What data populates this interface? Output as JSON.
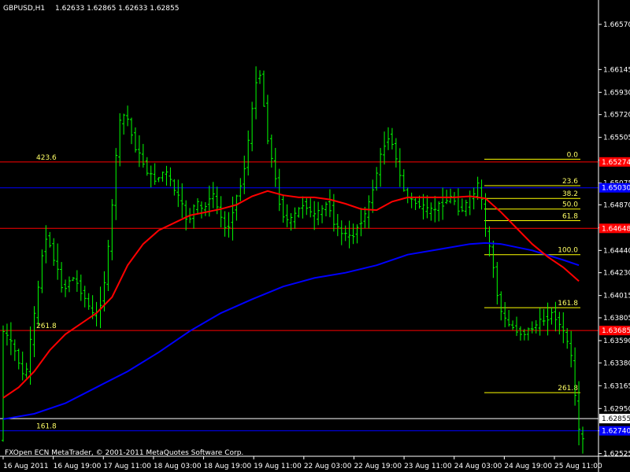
{
  "header": {
    "symbol": "GBPUSD,H1",
    "ohlc": "1.62633 1.62865 1.62633 1.62855"
  },
  "footer": {
    "copyright": "FXOpen ECN MetaTrader, © 2001-2011 MetaQuotes Software Corp."
  },
  "colors": {
    "background": "#000000",
    "candle": "#00ff00",
    "ma_fast": "#ff0000",
    "ma_slow": "#0000ff",
    "fib": "#ffff00",
    "level_red": "#ff0000",
    "level_blue": "#0000ff",
    "current_price": "#ffffff"
  },
  "chart_data": {
    "type": "candlestick",
    "ylim": [
      1.625,
      1.668
    ],
    "y_ticks": [
      "1.66570",
      "1.66145",
      "1.65930",
      "1.65720",
      "1.65505",
      "1.65290",
      "1.65075",
      "1.64870",
      "1.64655",
      "1.64440",
      "1.64230",
      "1.64015",
      "1.63805",
      "1.63590",
      "1.63380",
      "1.63165",
      "1.62950",
      "1.62740",
      "1.62525"
    ],
    "x_ticks": [
      "16 Aug 2011",
      "16 Aug 19:00",
      "17 Aug 11:00",
      "18 Aug 03:00",
      "18 Aug 19:00",
      "19 Aug 11:00",
      "22 Aug 03:00",
      "22 Aug 19:00",
      "23 Aug 11:00",
      "24 Aug 03:00",
      "24 Aug 19:00",
      "25 Aug 11:00"
    ],
    "price_path": [
      [
        0,
        1.637
      ],
      [
        2,
        1.636
      ],
      [
        4,
        1.6345
      ],
      [
        6,
        1.632
      ],
      [
        8,
        1.637
      ],
      [
        10,
        1.642
      ],
      [
        11,
        1.646
      ],
      [
        12,
        1.6455
      ],
      [
        14,
        1.643
      ],
      [
        16,
        1.6405
      ],
      [
        18,
        1.642
      ],
      [
        20,
        1.641
      ],
      [
        22,
        1.6395
      ],
      [
        24,
        1.638
      ],
      [
        26,
        1.64
      ],
      [
        28,
        1.646
      ],
      [
        30,
        1.656
      ],
      [
        32,
        1.6575
      ],
      [
        34,
        1.6545
      ],
      [
        36,
        1.653
      ],
      [
        38,
        1.6515
      ],
      [
        40,
        1.651
      ],
      [
        42,
        1.652
      ],
      [
        44,
        1.6505
      ],
      [
        46,
        1.649
      ],
      [
        48,
        1.647
      ],
      [
        50,
        1.649
      ],
      [
        52,
        1.648
      ],
      [
        54,
        1.65
      ],
      [
        56,
        1.648
      ],
      [
        58,
        1.646
      ],
      [
        60,
        1.649
      ],
      [
        62,
        1.651
      ],
      [
        64,
        1.656
      ],
      [
        66,
        1.662
      ],
      [
        67,
        1.66
      ],
      [
        68,
        1.656
      ],
      [
        70,
        1.652
      ],
      [
        72,
        1.648
      ],
      [
        74,
        1.647
      ],
      [
        76,
        1.648
      ],
      [
        78,
        1.649
      ],
      [
        80,
        1.6475
      ],
      [
        82,
        1.648
      ],
      [
        84,
        1.649
      ],
      [
        86,
        1.6465
      ],
      [
        88,
        1.646
      ],
      [
        90,
        1.6455
      ],
      [
        92,
        1.647
      ],
      [
        94,
        1.648
      ],
      [
        96,
        1.651
      ],
      [
        98,
        1.654
      ],
      [
        100,
        1.6555
      ],
      [
        102,
        1.652
      ],
      [
        104,
        1.6495
      ],
      [
        106,
        1.649
      ],
      [
        108,
        1.6485
      ],
      [
        110,
        1.648
      ],
      [
        112,
        1.6485
      ],
      [
        114,
        1.649
      ],
      [
        116,
        1.6495
      ],
      [
        118,
        1.648
      ],
      [
        120,
        1.649
      ],
      [
        122,
        1.65
      ],
      [
        123,
        1.651
      ],
      [
        124,
        1.647
      ],
      [
        126,
        1.644
      ],
      [
        128,
        1.639
      ],
      [
        130,
        1.6375
      ],
      [
        132,
        1.637
      ],
      [
        134,
        1.6365
      ],
      [
        136,
        1.637
      ],
      [
        138,
        1.6375
      ],
      [
        140,
        1.638
      ],
      [
        142,
        1.6385
      ],
      [
        144,
        1.637
      ],
      [
        146,
        1.6355
      ],
      [
        147,
        1.633
      ],
      [
        148,
        1.628
      ],
      [
        149,
        1.6265
      ]
    ],
    "ma_fast": [
      [
        0,
        1.6305
      ],
      [
        4,
        1.6315
      ],
      [
        8,
        1.633
      ],
      [
        12,
        1.635
      ],
      [
        16,
        1.6365
      ],
      [
        20,
        1.6375
      ],
      [
        24,
        1.6385
      ],
      [
        28,
        1.64
      ],
      [
        32,
        1.643
      ],
      [
        36,
        1.645
      ],
      [
        40,
        1.6463
      ],
      [
        44,
        1.647
      ],
      [
        48,
        1.6477
      ],
      [
        52,
        1.648
      ],
      [
        56,
        1.6483
      ],
      [
        60,
        1.6487
      ],
      [
        64,
        1.6495
      ],
      [
        68,
        1.65
      ],
      [
        72,
        1.6496
      ],
      [
        76,
        1.6494
      ],
      [
        80,
        1.6494
      ],
      [
        84,
        1.6492
      ],
      [
        88,
        1.6488
      ],
      [
        92,
        1.6483
      ],
      [
        96,
        1.6482
      ],
      [
        100,
        1.649
      ],
      [
        104,
        1.6494
      ],
      [
        108,
        1.6494
      ],
      [
        112,
        1.6494
      ],
      [
        116,
        1.6494
      ],
      [
        120,
        1.6495
      ],
      [
        124,
        1.6493
      ],
      [
        128,
        1.648
      ],
      [
        132,
        1.6465
      ],
      [
        136,
        1.645
      ],
      [
        140,
        1.6438
      ],
      [
        144,
        1.6428
      ],
      [
        148,
        1.6415
      ]
    ],
    "ma_slow": [
      [
        0,
        1.6285
      ],
      [
        8,
        1.629
      ],
      [
        16,
        1.63
      ],
      [
        24,
        1.6315
      ],
      [
        32,
        1.633
      ],
      [
        40,
        1.6348
      ],
      [
        48,
        1.6368
      ],
      [
        56,
        1.6385
      ],
      [
        64,
        1.6398
      ],
      [
        72,
        1.641
      ],
      [
        80,
        1.6418
      ],
      [
        88,
        1.6423
      ],
      [
        96,
        1.643
      ],
      [
        104,
        1.644
      ],
      [
        112,
        1.6445
      ],
      [
        120,
        1.645
      ],
      [
        124,
        1.6451
      ],
      [
        128,
        1.645
      ],
      [
        136,
        1.6444
      ],
      [
        144,
        1.6435
      ],
      [
        148,
        1.643
      ]
    ],
    "levels": [
      {
        "price": 1.65274,
        "color": "#ff0000",
        "label": "423.6",
        "tag": "1.65274"
      },
      {
        "price": 1.6503,
        "color": "#0000ff",
        "label": "",
        "tag": "1.65030"
      },
      {
        "price": 1.64648,
        "color": "#ff0000",
        "label": "",
        "tag": "1.64648"
      },
      {
        "price": 1.63685,
        "color": "#ff0000",
        "label": "261.8",
        "tag": "1.63685"
      },
      {
        "price": 1.6274,
        "color": "#0000ff",
        "label": "161.8",
        "tag": "1.62740"
      },
      {
        "price": 1.62855,
        "color": "#ffffff",
        "label": "",
        "tag": "1.62855"
      }
    ],
    "fib_levels": [
      {
        "label": "0.0",
        "price": 1.653
      },
      {
        "label": "23.6",
        "price": 1.6505
      },
      {
        "label": "38.2",
        "price": 1.6493
      },
      {
        "label": "50.0",
        "price": 1.6483
      },
      {
        "label": "61.8",
        "price": 1.6472
      },
      {
        "label": "100.0",
        "price": 1.644
      },
      {
        "label": "161.8",
        "price": 1.639
      },
      {
        "label": "261.8",
        "price": 1.631
      }
    ]
  }
}
